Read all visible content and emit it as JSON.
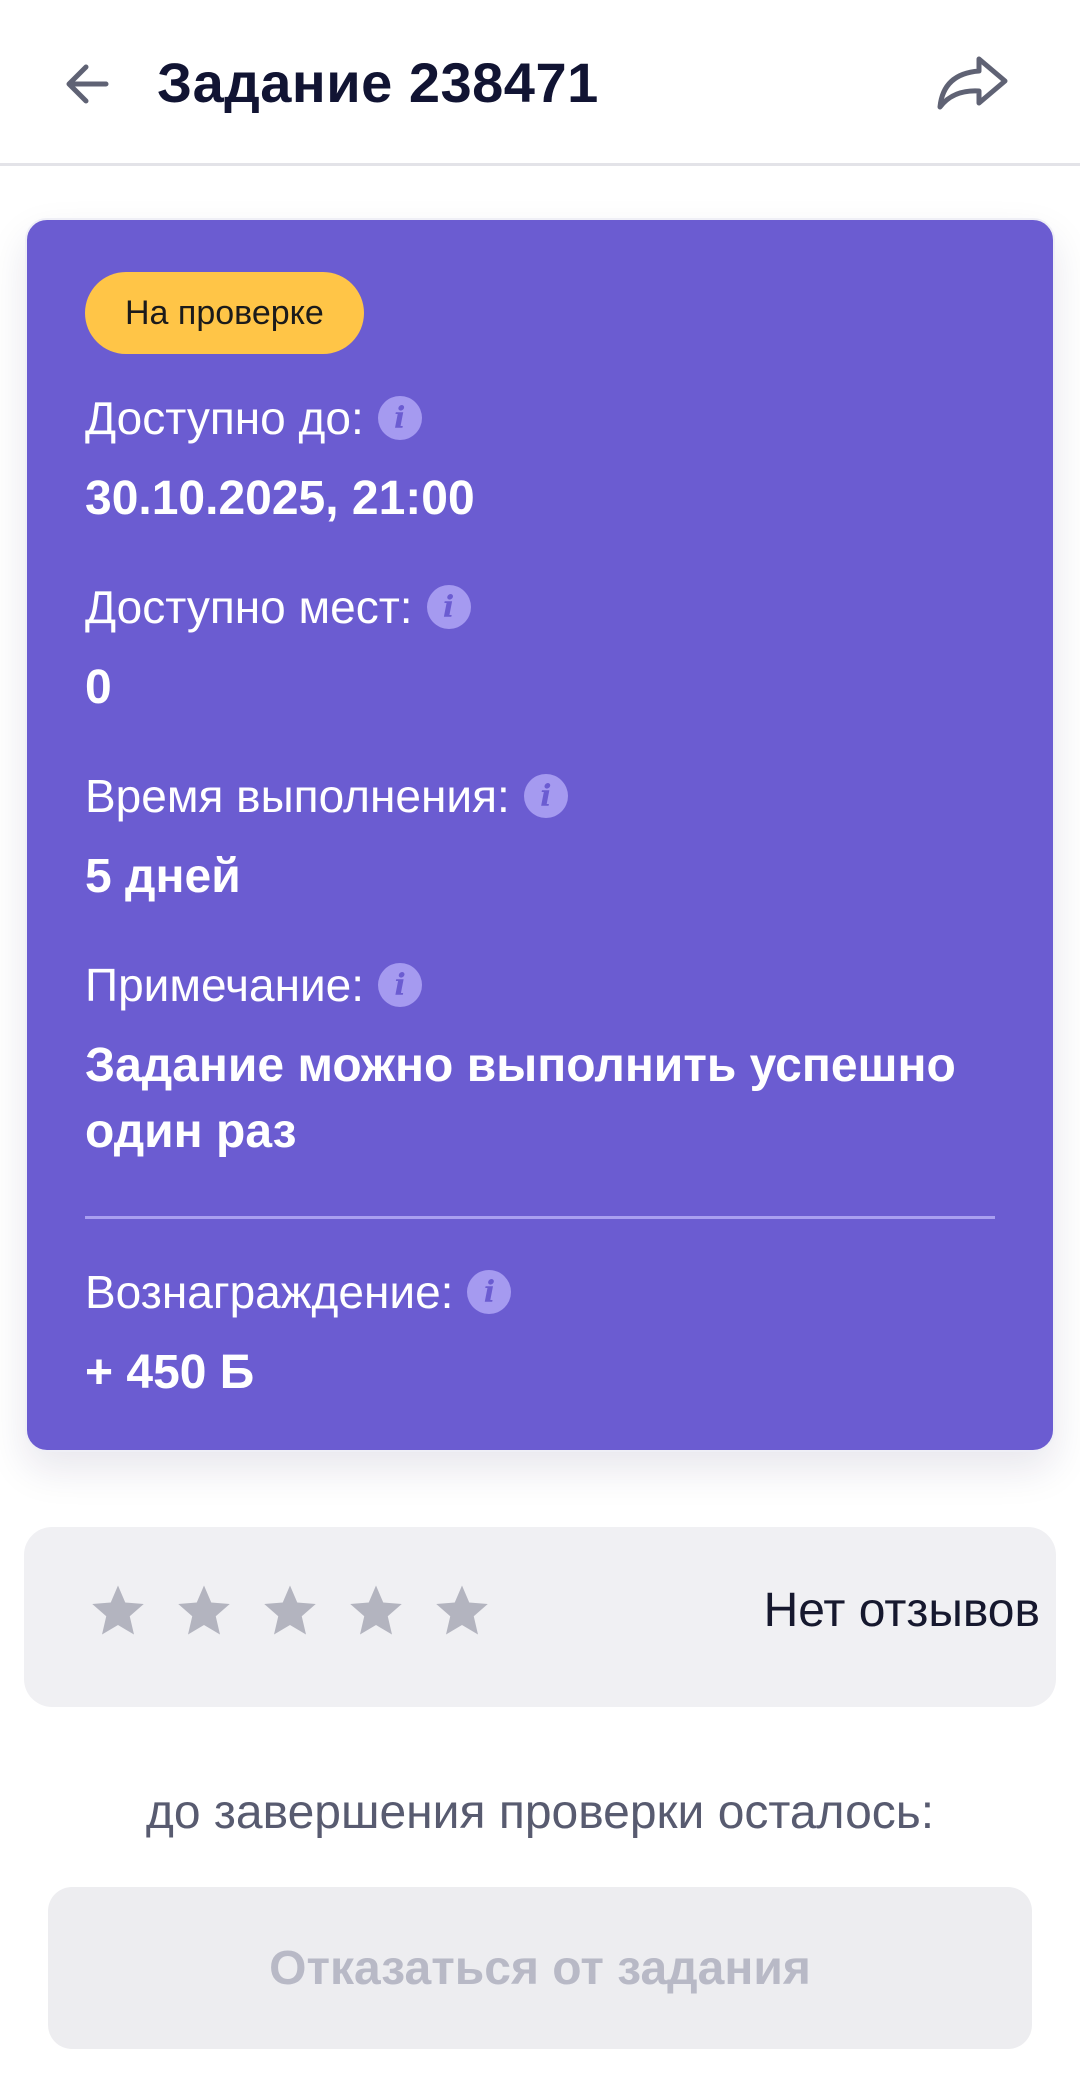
{
  "header": {
    "title": "Задание 238471",
    "back_icon": "arrow-left-icon",
    "share_icon": "share-icon"
  },
  "card": {
    "status_badge": "На проверке",
    "available_until": {
      "label": "Доступно до:",
      "value": "30.10.2025, 21:00"
    },
    "available_places": {
      "label": "Доступно мест:",
      "value": "0"
    },
    "completion_time": {
      "label": "Время выполнения:",
      "value": "5 дней"
    },
    "note": {
      "label": "Примечание:",
      "value": "Задание можно выполнить успешно один раз"
    },
    "reward": {
      "label": "Вознаграждение:",
      "value": "+ 450 Б"
    },
    "info_icon_glyph": "i"
  },
  "rating": {
    "stars_total": 5,
    "stars_filled": 0,
    "reviews_text": "Нет отзывов"
  },
  "countdown_text": "до завершения проверки осталось:",
  "cancel_button_label": "Отказаться от задания",
  "colors": {
    "card_bg": "#6b5cd1",
    "badge_bg": "#ffc547",
    "star_empty": "#b3b4bf",
    "disabled_text": "#b8b9c6"
  }
}
